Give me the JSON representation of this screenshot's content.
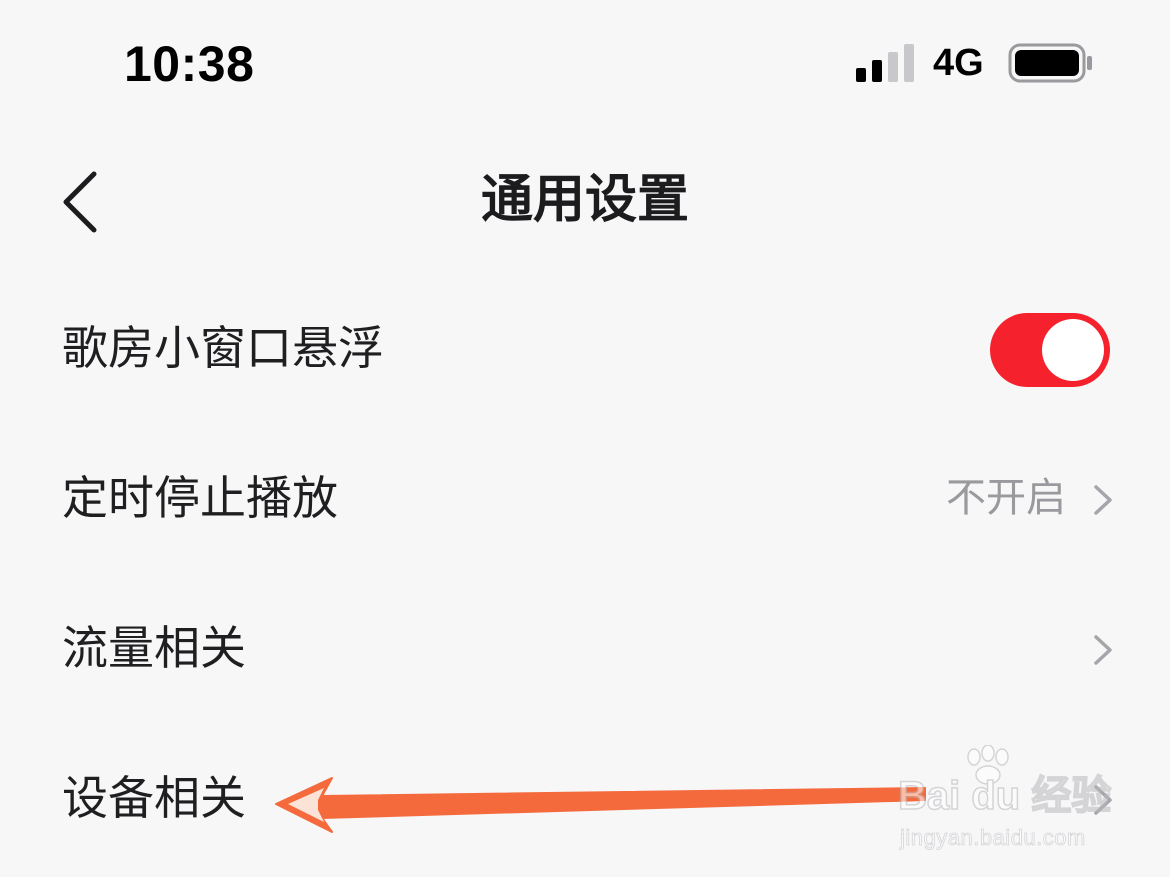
{
  "status_bar": {
    "time": "10:38",
    "network": "4G",
    "signal_icon": "cellular-signal-icon",
    "battery_icon": "battery-icon"
  },
  "nav": {
    "title": "通用设置",
    "back_icon": "chevron-left-icon"
  },
  "settings": [
    {
      "label": "歌房小窗口悬浮",
      "control": "toggle",
      "toggle_on": true
    },
    {
      "label": "定时停止播放",
      "value": "不开启",
      "control": "chevron"
    },
    {
      "label": "流量相关",
      "control": "chevron"
    },
    {
      "label": "设备相关",
      "control": "chevron"
    }
  ],
  "watermark": {
    "brand": "Bai du 经验",
    "url": "jingyan.baidu.com"
  },
  "colors": {
    "background": "#f7f7f8",
    "toggle_on": "#f5222d",
    "annotation_arrow": "#f46a3c",
    "secondary_text": "#9a9a9e"
  }
}
